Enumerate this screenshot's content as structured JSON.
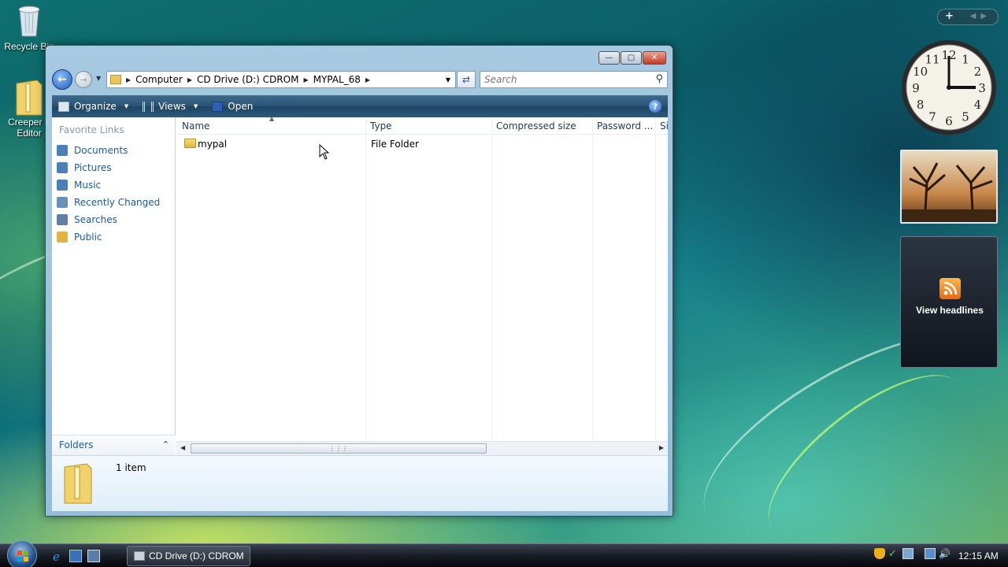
{
  "desktop": {
    "icons": [
      {
        "label": "Recycle Bin"
      },
      {
        "label": "Creeper T Editor"
      }
    ]
  },
  "window": {
    "caption": {
      "minimize": "—",
      "maximize": "▢",
      "close": "✕"
    },
    "breadcrumb": [
      "Computer",
      "CD Drive (D:) CDROM",
      "MYPAL_68"
    ],
    "search": {
      "placeholder": "Search"
    },
    "toolbar": {
      "organize": "Organize",
      "views": "Views",
      "open": "Open",
      "help": "?"
    },
    "nav_pane": {
      "title": "Favorite Links",
      "links": [
        {
          "label": "Documents",
          "color": "#4a7fb8"
        },
        {
          "label": "Pictures",
          "color": "#4a7fb8"
        },
        {
          "label": "Music",
          "color": "#4a7fb8"
        },
        {
          "label": "Recently Changed",
          "color": "#6a8fb8"
        },
        {
          "label": "Searches",
          "color": "#5f7fa5"
        },
        {
          "label": "Public",
          "color": "#e0b443"
        }
      ],
      "folders_label": "Folders"
    },
    "columns": [
      "Name",
      "Type",
      "Compressed size",
      "Password ...",
      "Si"
    ],
    "rows": [
      {
        "name": "mypal",
        "type": "File Folder"
      }
    ],
    "details": {
      "count": "1 item"
    }
  },
  "gadgets": {
    "clock": {
      "time": "3:00",
      "numbers": [
        "12",
        "1",
        "2",
        "3",
        "4",
        "5",
        "6",
        "7",
        "8",
        "9",
        "10",
        "11"
      ]
    },
    "feed": {
      "label": "View headlines"
    }
  },
  "taskbar": {
    "active_task": "CD Drive (D:) CDROM",
    "clock": "12:15 AM"
  }
}
